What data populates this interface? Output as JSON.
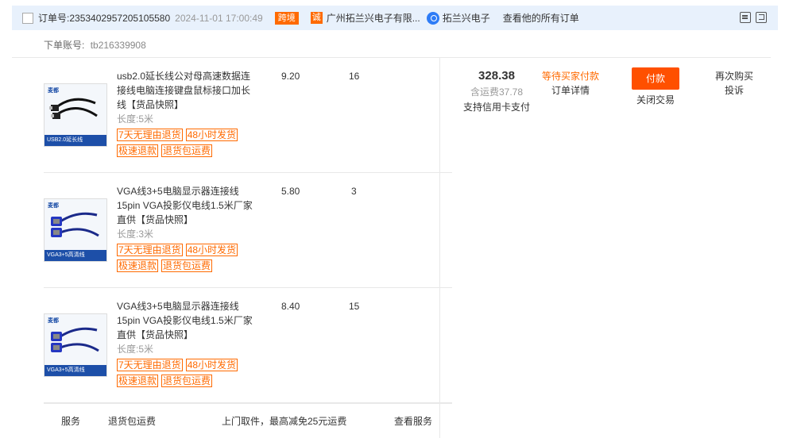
{
  "header": {
    "order_label": "订单号:",
    "order_no": "2353402957205105580",
    "order_time": "2024-11-01 17:00:49",
    "badge": "跨境",
    "shop_logo_char": "诚",
    "shop_name": "广州拓兰兴电子有限...",
    "seller": "拓兰兴电子",
    "all_orders": "查看他的所有订单"
  },
  "account": {
    "label": "下单账号:",
    "value": "tb216339908"
  },
  "items": [
    {
      "title": "usb2.0延长线公对母高速数据连接线电脑连接键盘鼠标接口加长线",
      "snapshot": "【货品快照】",
      "spec": "长度:5米",
      "price": "9.20",
      "qty": "16",
      "thumb_brand": "麦都",
      "thumb_strip": "USB2.0延长线"
    },
    {
      "title": "VGA线3+5电脑显示器连接线15pin VGA投影仪电线1.5米厂家直供",
      "snapshot": "【货品快照】",
      "spec": "长度:3米",
      "price": "5.80",
      "qty": "3",
      "thumb_brand": "麦都",
      "thumb_strip": "VGA3+5高清线"
    },
    {
      "title": "VGA线3+5电脑显示器连接线15pin VGA投影仪电线1.5米厂家直供",
      "snapshot": "【货品快照】",
      "spec": "长度:5米",
      "price": "8.40",
      "qty": "15",
      "thumb_brand": "麦都",
      "thumb_strip": "VGA3+5高清线"
    }
  ],
  "tags": {
    "return7": "7天无理由退货",
    "ship48": "48小时发货",
    "fast_refund": "极速退款",
    "return_ship": "退货包运费"
  },
  "service": {
    "label": "服务",
    "name": "退货包运费",
    "desc": "上门取件，最高减免25元运费",
    "link": "查看服务"
  },
  "summary": {
    "total": "328.38",
    "shipping": "含运费37.78",
    "credit": "支持信用卡支付"
  },
  "status": {
    "state": "等待买家付款",
    "detail": "订单详情"
  },
  "actions": {
    "pay": "付款",
    "close": "关闭交易",
    "rebuy": "再次购买",
    "complain": "投诉"
  },
  "colors": {
    "accent": "#ff6a00",
    "pay_button": "#ff5000",
    "header_bg": "#e8f1fc"
  }
}
